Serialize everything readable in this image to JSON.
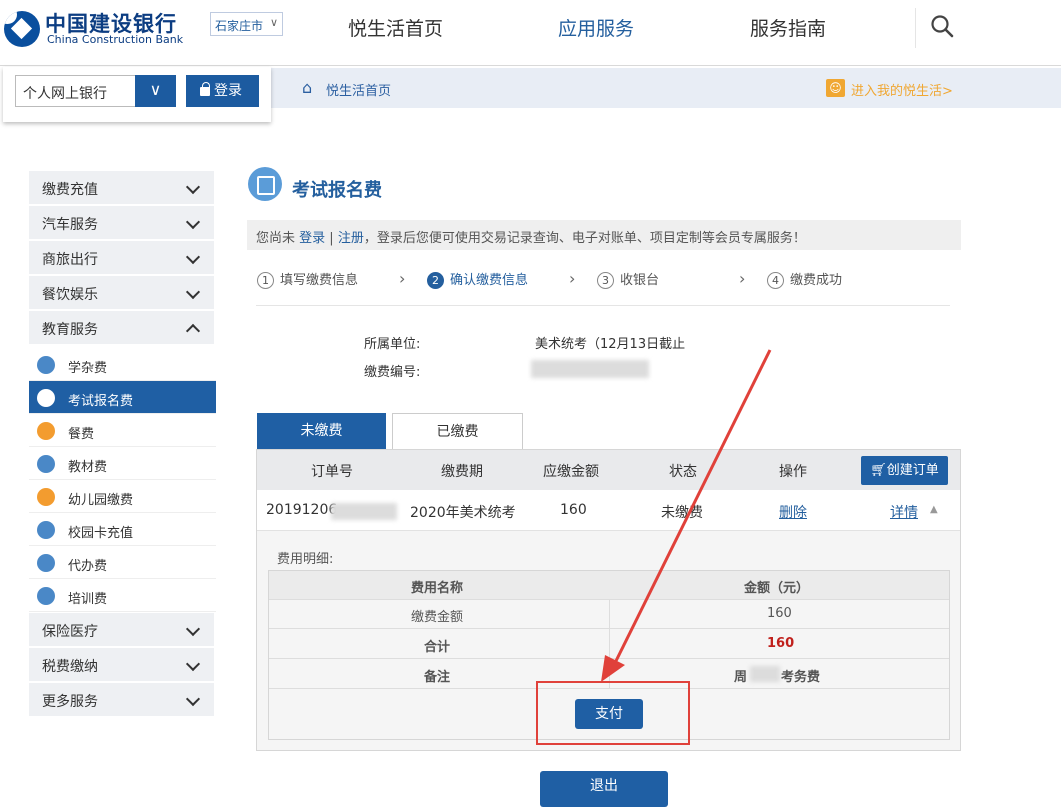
{
  "header": {
    "logo_cn": "中国建设银行",
    "logo_en": "China Construction Bank",
    "city": "石家庄市",
    "nav": [
      "悦生活首页",
      "应用服务",
      "服务指南"
    ],
    "active_nav": "应用服务"
  },
  "login": {
    "select_value": "个人网上银行",
    "login_label": "登录"
  },
  "breadcrumb": {
    "home": "悦生活首页",
    "my_link": "进入我的悦生活>"
  },
  "sidebar": {
    "top_items": [
      "缴费充值",
      "汽车服务",
      "商旅出行",
      "餐饮娱乐",
      "教育服务"
    ],
    "sub_items": [
      "学杂费",
      "考试报名费",
      "餐费",
      "教材费",
      "幼儿园缴费",
      "校园卡充值",
      "代办费",
      "培训费"
    ],
    "selected_sub": "考试报名费",
    "bottom_items": [
      "保险医疗",
      "税费缴纳",
      "更多服务"
    ]
  },
  "main": {
    "title": "考试报名费",
    "notice_prefix": "您尚未 ",
    "notice_login": "登录",
    "notice_sep": " | ",
    "notice_register": "注册",
    "notice_suffix": "，登录后您便可使用交易记录查询、电子对账单、项目定制等会员专属服务！",
    "steps": [
      {
        "num": "1",
        "label": "填写缴费信息"
      },
      {
        "num": "2",
        "label": "确认缴费信息"
      },
      {
        "num": "3",
        "label": "收银台"
      },
      {
        "num": "4",
        "label": "缴费成功"
      }
    ],
    "active_step": 2,
    "unit_label": "所属单位:",
    "unit_value": "美术统考（12月13日截止",
    "code_label": "缴费编号:",
    "tabs": [
      "未缴费",
      "已缴费"
    ],
    "table": {
      "headers": [
        "订单号",
        "缴费期",
        "应缴金额",
        "状态",
        "操作"
      ],
      "create_btn": "创建订单",
      "row": {
        "order_no": "20191206",
        "period": "2020年美术统考",
        "amount": "160",
        "status": "未缴费",
        "delete": "删除",
        "detail": "详情"
      }
    },
    "detail": {
      "label": "费用明细:",
      "headers": [
        "费用名称",
        "金额（元）"
      ],
      "rows": [
        {
          "name": "缴费金额",
          "amount": "160"
        },
        {
          "name": "合计",
          "amount": "160"
        },
        {
          "name": "备注",
          "amount_prefix": "周",
          "amount_suffix": "考务费"
        }
      ]
    },
    "pay_btn": "支付",
    "exit_btn": "退出"
  },
  "colors": {
    "brand_blue": "#1f5fa4",
    "annotation_red": "#e0413a",
    "total_red": "#c0201c"
  }
}
